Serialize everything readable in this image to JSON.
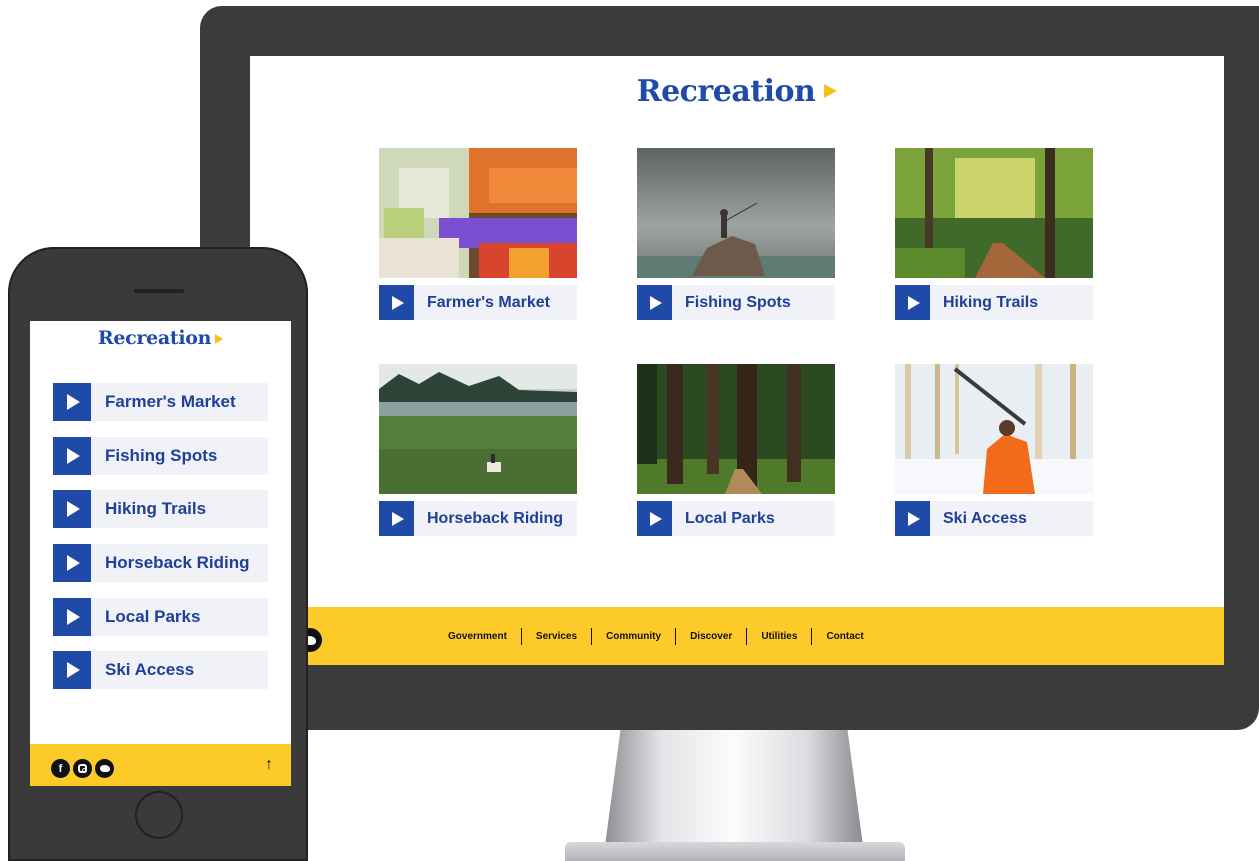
{
  "title": "Recreation",
  "activities": [
    {
      "label": "Farmer's Market",
      "image": "farmers-market-photo"
    },
    {
      "label": "Fishing Spots",
      "image": "fishing-spots-photo"
    },
    {
      "label": "Hiking Trails",
      "image": "hiking-trails-photo"
    },
    {
      "label": "Horseback Riding",
      "image": "horseback-riding-photo"
    },
    {
      "label": "Local Parks",
      "image": "local-parks-photo"
    },
    {
      "label": "Ski Access",
      "image": "ski-access-photo"
    }
  ],
  "footer": {
    "nav": [
      "Government",
      "Services",
      "Community",
      "Discover",
      "Utilities",
      "Contact"
    ],
    "active": "Discover",
    "social": [
      "facebook-icon",
      "instagram-icon",
      "twitter-icon"
    ],
    "social_glyphs": {
      "facebook": "f"
    },
    "back_to_top": "↑"
  },
  "colors": {
    "brand_blue": "#1f4aa8",
    "accent_yellow": "#fccb2a",
    "tile_bg": "#f0f2f8"
  }
}
